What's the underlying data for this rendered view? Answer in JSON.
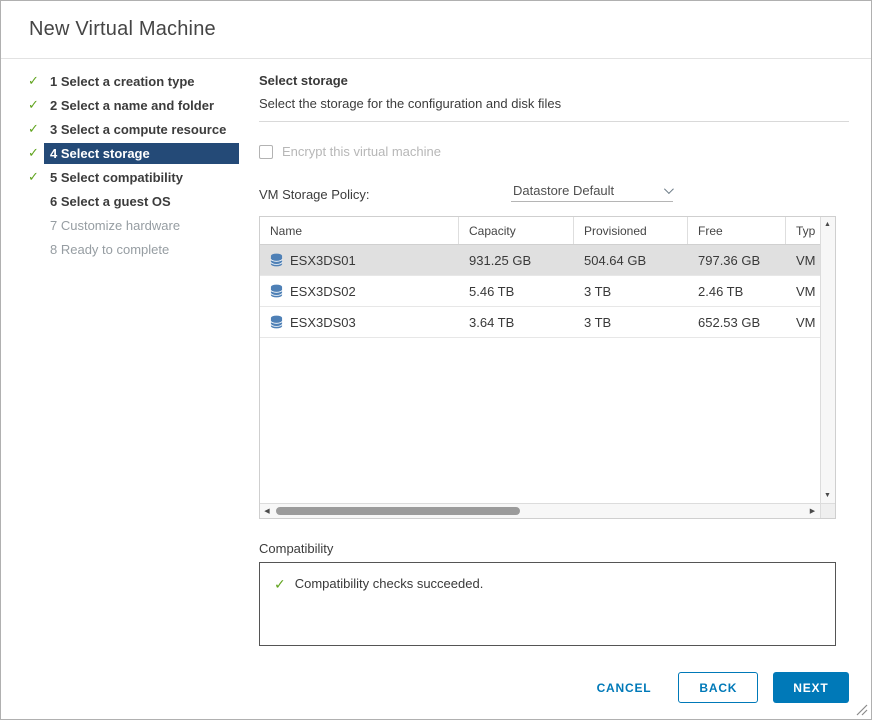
{
  "window": {
    "title": "New Virtual Machine"
  },
  "colors": {
    "accent_blue": "#0079B8",
    "active_step_bg": "#244A77",
    "success_green": "#61A41F",
    "selected_row_bg": "#E0E0E0"
  },
  "icons": {
    "check": "✓",
    "scroll_up": "▲",
    "scroll_down": "▼",
    "scroll_left": "◀",
    "scroll_right": "▶"
  },
  "steps": [
    {
      "label": "1 Select a creation type",
      "completed": true,
      "active": false
    },
    {
      "label": "2 Select a name and folder",
      "completed": true,
      "active": false
    },
    {
      "label": "3 Select a compute resource",
      "completed": true,
      "active": false
    },
    {
      "label": "4 Select storage",
      "completed": true,
      "active": true
    },
    {
      "label": "5 Select compatibility",
      "completed": true,
      "active": false
    },
    {
      "label": "6 Select a guest OS",
      "completed": false,
      "active": false
    },
    {
      "label": "7 Customize hardware",
      "completed": false,
      "active": false
    },
    {
      "label": "8 Ready to complete",
      "completed": false,
      "active": false
    }
  ],
  "page": {
    "heading": "Select storage",
    "subheading": "Select the storage for the configuration and disk files",
    "encrypt_checkbox_label": "Encrypt this virtual machine",
    "encrypt_checked": false,
    "storage_policy_label": "VM Storage Policy:",
    "storage_policy_value": "Datastore Default"
  },
  "datastore_table": {
    "columns": [
      "Name",
      "Capacity",
      "Provisioned",
      "Free",
      "Typ"
    ],
    "rows": [
      {
        "name": "ESX3DS01",
        "capacity": "931.25 GB",
        "provisioned": "504.64 GB",
        "free": "797.36 GB",
        "type": "VM",
        "selected": true
      },
      {
        "name": "ESX3DS02",
        "capacity": "5.46 TB",
        "provisioned": "3 TB",
        "free": "2.46 TB",
        "type": "VM",
        "selected": false
      },
      {
        "name": "ESX3DS03",
        "capacity": "3.64 TB",
        "provisioned": "3 TB",
        "free": "652.53 GB",
        "type": "VM",
        "selected": false
      }
    ]
  },
  "compatibility": {
    "label": "Compatibility",
    "message": "Compatibility checks succeeded."
  },
  "footer": {
    "cancel_label": "CANCEL",
    "back_label": "BACK",
    "next_label": "NEXT"
  }
}
